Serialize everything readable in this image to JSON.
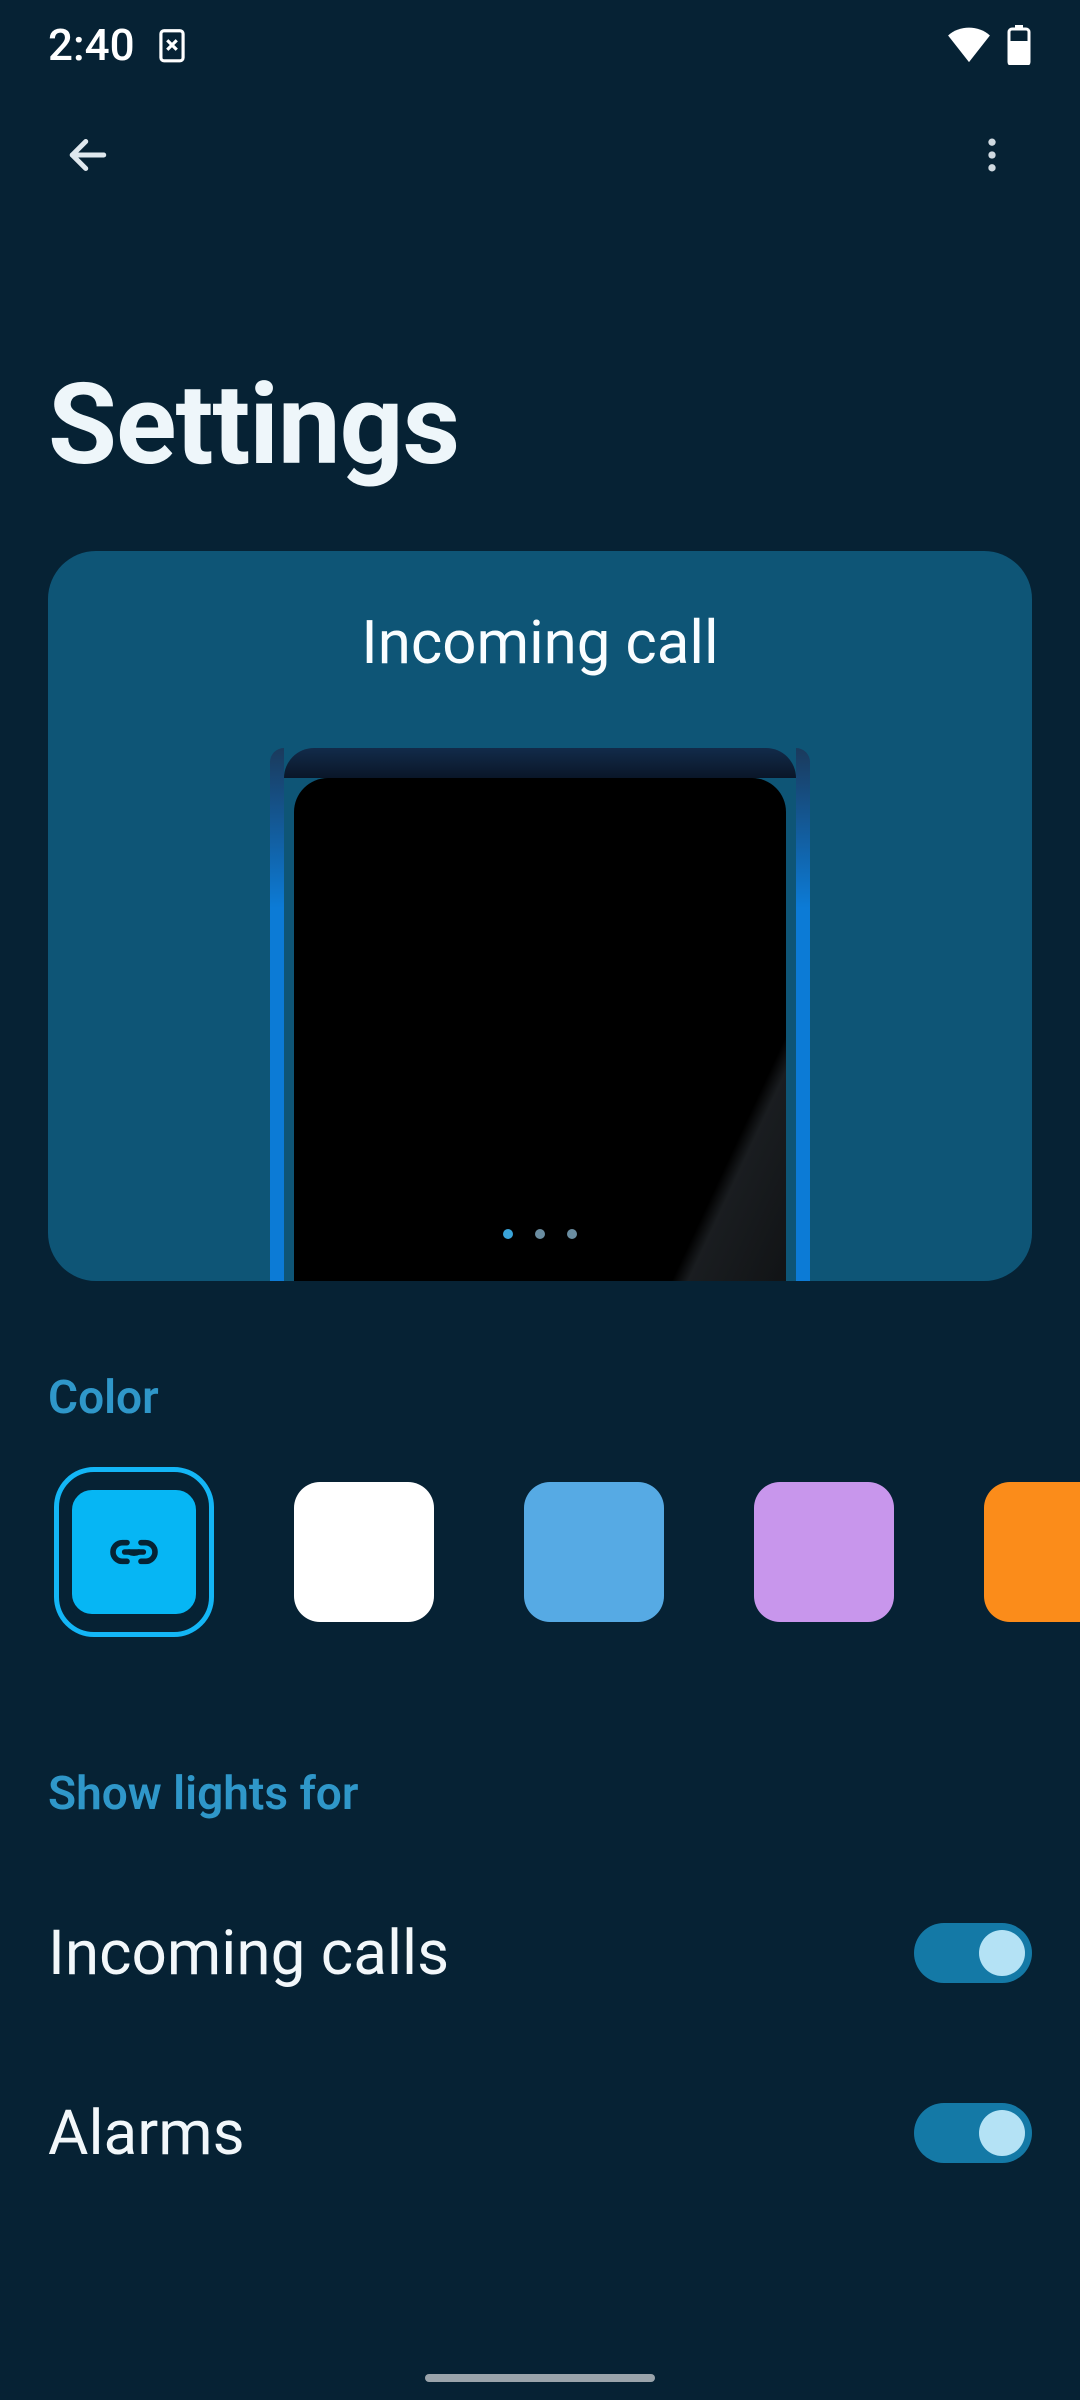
{
  "status_bar": {
    "time": "2:40"
  },
  "app_bar": {
    "back": "back",
    "more": "more"
  },
  "page_title": "Settings",
  "preview": {
    "title": "Incoming call",
    "page_count": 3,
    "active_page": 0
  },
  "sections": {
    "color": {
      "header": "Color",
      "swatches": [
        {
          "id": "linked",
          "color": "#06b6f4",
          "selected": true,
          "has_link_icon": true
        },
        {
          "id": "white",
          "color": "#ffffff",
          "selected": false,
          "has_link_icon": false
        },
        {
          "id": "blue",
          "color": "#56aae4",
          "selected": false,
          "has_link_icon": false
        },
        {
          "id": "purple",
          "color": "#c896ec",
          "selected": false,
          "has_link_icon": false
        },
        {
          "id": "orange",
          "color": "#fb8c1a",
          "selected": false,
          "has_link_icon": false
        }
      ]
    },
    "show_lights": {
      "header": "Show lights for",
      "items": [
        {
          "label": "Incoming calls",
          "on": true
        },
        {
          "label": "Alarms",
          "on": true
        }
      ]
    }
  },
  "colors": {
    "bg": "#062234",
    "card": "#0e5576",
    "accent": "#2f97c9",
    "toggle_on": "#1479a6",
    "toggle_knob": "#b4e2f5"
  }
}
